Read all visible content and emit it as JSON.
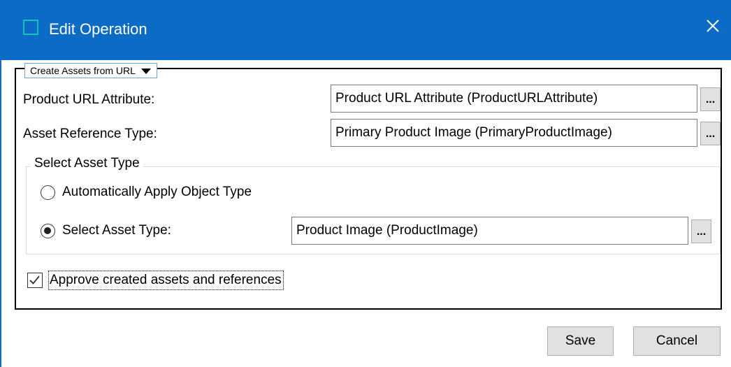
{
  "window": {
    "title": "Edit Operation",
    "icon": "app-window-icon",
    "close_icon": "close-icon",
    "accent_color": "#0b6bc6"
  },
  "operation": {
    "mode_selected": "Create Assets from URL"
  },
  "fields": {
    "product_url": {
      "label": "Product URL Attribute:",
      "value": "Product URL Attribute (ProductURLAttribute)",
      "browse_label": "..."
    },
    "asset_reference_type": {
      "label": "Asset Reference Type:",
      "value": "Primary Product Image (PrimaryProductImage)",
      "browse_label": "..."
    }
  },
  "select_asset_type": {
    "legend": "Select Asset Type",
    "options": [
      {
        "label": "Automatically Apply Object Type",
        "selected": false
      },
      {
        "label": "Select Asset Type:",
        "selected": true
      }
    ],
    "asset_type_value": "Product Image (ProductImage)",
    "browse_label": "..."
  },
  "approve": {
    "label": "Approve created assets and references",
    "checked": true
  },
  "buttons": {
    "save": "Save",
    "cancel": "Cancel"
  }
}
